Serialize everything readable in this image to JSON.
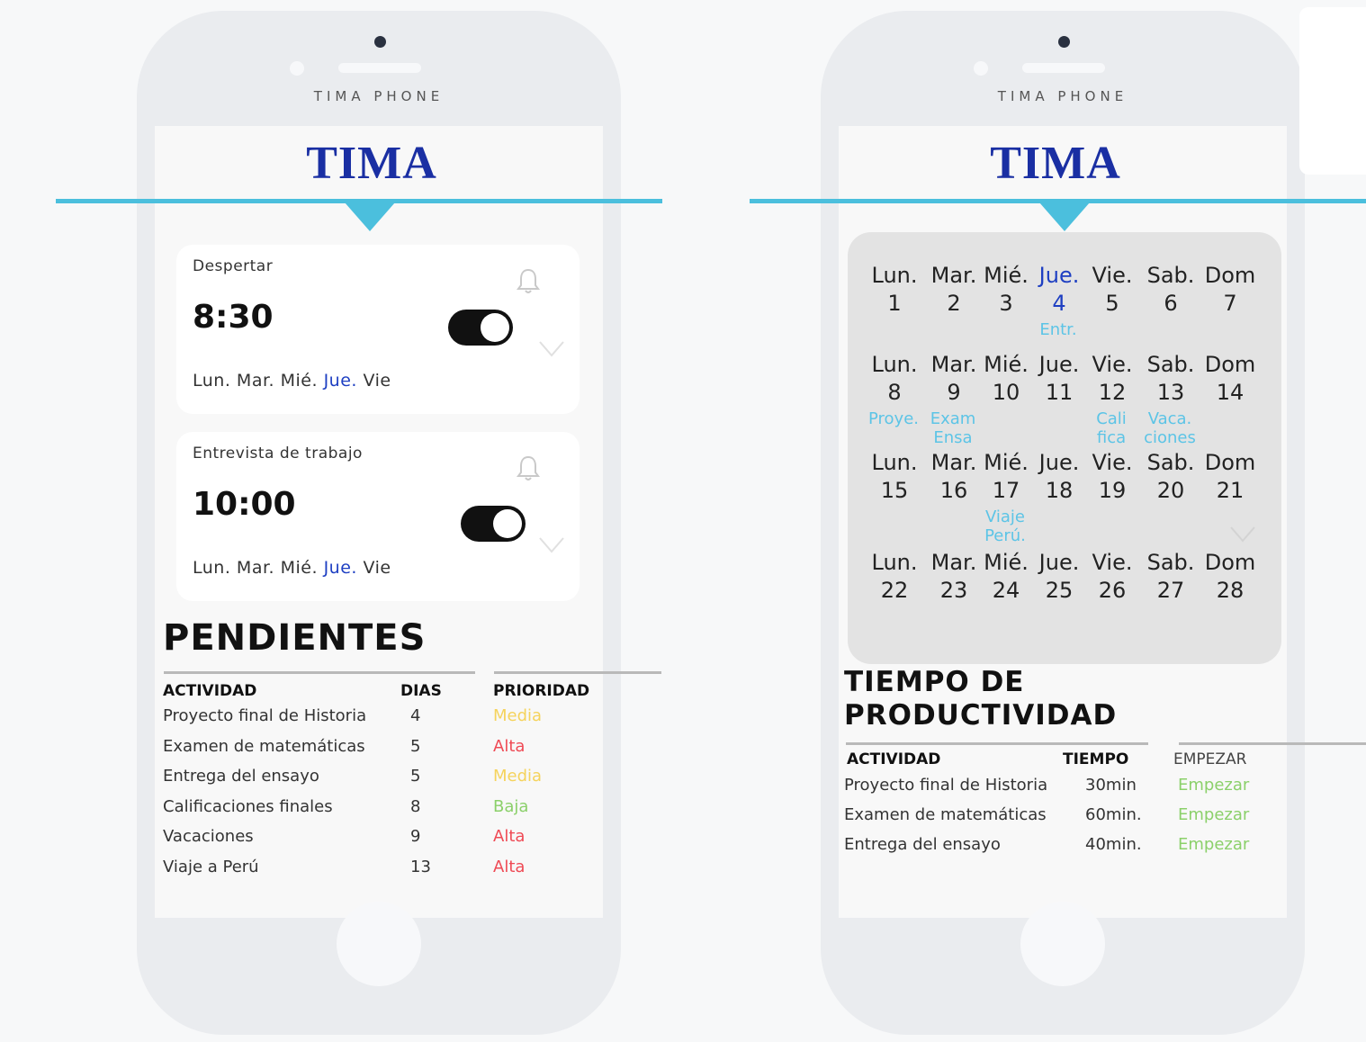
{
  "phone": {
    "brand": "TIMA PHONE"
  },
  "app": {
    "title": "TIMA"
  },
  "alarms": [
    {
      "label": "Despertar",
      "time": "8:30",
      "enabled": true,
      "days": [
        "Lun.",
        "Mar.",
        "Mié.",
        "Jue.",
        "Vie"
      ],
      "highlight_day": "Jue."
    },
    {
      "label": "Entrevista de trabajo",
      "time": "10:00",
      "enabled": true,
      "days": [
        "Lun.",
        "Mar.",
        "Mié.",
        "Jue.",
        "Vie"
      ],
      "highlight_day": "Jue."
    }
  ],
  "pendientes": {
    "title": "PENDIENTES",
    "columns": {
      "actividad": "ACTIVIDAD",
      "dias": "DIAS",
      "prioridad": "PRIORIDAD"
    },
    "rows": [
      {
        "actividad": "Proyecto final de Historia",
        "dias": "4",
        "prioridad": "Media"
      },
      {
        "actividad": "Examen de matemáticas",
        "dias": "5",
        "prioridad": "Alta"
      },
      {
        "actividad": "Entrega del ensayo",
        "dias": "5",
        "prioridad": "Media"
      },
      {
        "actividad": "Calificaciones finales",
        "dias": "8",
        "prioridad": "Baja"
      },
      {
        "actividad": "Vacaciones",
        "dias": "9",
        "prioridad": "Alta"
      },
      {
        "actividad": "Viaje a Perú",
        "dias": "13",
        "prioridad": "Alta"
      }
    ],
    "priority_colors": {
      "Media": "#f5d35c",
      "Alta": "#ef4a55",
      "Baja": "#8bd06a"
    }
  },
  "calendar": {
    "day_labels": [
      "Lun.",
      "Mar.",
      "Mié.",
      "Jue.",
      "Vie.",
      "Sab.",
      "Dom"
    ],
    "highlight_color": "#1e3fc2",
    "event_color": "#5cc4e6",
    "weeks": [
      {
        "numbers": [
          "1",
          "2",
          "3",
          "4",
          "5",
          "6",
          "7"
        ],
        "highlight_index": 3,
        "events": [
          "",
          "",
          "",
          "Entr.",
          "",
          "",
          ""
        ]
      },
      {
        "numbers": [
          "8",
          "9",
          "10",
          "11",
          "12",
          "13",
          "14"
        ],
        "events": [
          "Proye.",
          "Exam Ensa",
          "",
          "",
          "Cali fica",
          "Vaca. ciones",
          ""
        ]
      },
      {
        "numbers": [
          "15",
          "16",
          "17",
          "18",
          "19",
          "20",
          "21"
        ],
        "events": [
          "",
          "",
          "Viaje Perú.",
          "",
          "",
          "",
          ""
        ]
      },
      {
        "numbers": [
          "22",
          "23",
          "24",
          "25",
          "26",
          "27",
          "28"
        ],
        "events": [
          "",
          "",
          "",
          "",
          "",
          "",
          ""
        ]
      }
    ]
  },
  "productividad": {
    "title_line1": "TIEMPO DE",
    "title_line2": "PRODUCTIVIDAD",
    "columns": {
      "actividad": "ACTIVIDAD",
      "tiempo": "TIEMPO",
      "empezar": "EMPEZAR"
    },
    "rows": [
      {
        "actividad": "Proyecto final de Historia",
        "tiempo": "30min",
        "accion": "Empezar"
      },
      {
        "actividad": "Examen de matemáticas",
        "tiempo": "60min.",
        "accion": "Empezar"
      },
      {
        "actividad": "Entrega del ensayo",
        "tiempo": "40min.",
        "accion": "Empezar"
      }
    ],
    "action_color": "#8bd06a"
  }
}
